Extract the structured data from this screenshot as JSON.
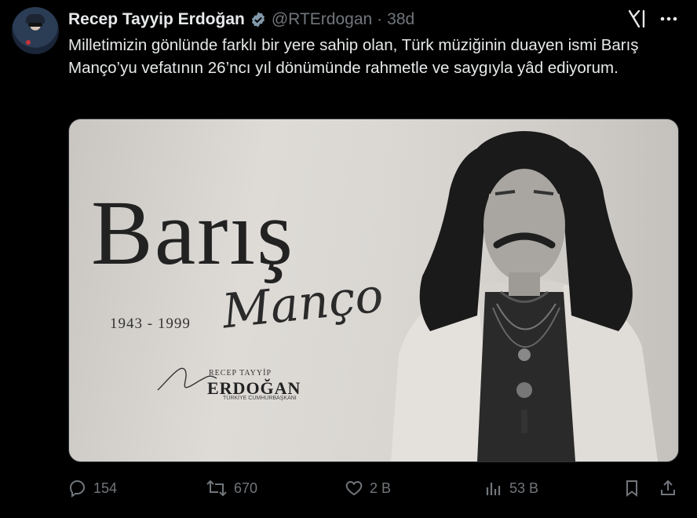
{
  "tweet": {
    "author_name": "Recep Tayyip Erdoğan",
    "handle": "@RTErdogan",
    "separator": "·",
    "time": "38d",
    "text": "Milletimizin gönlünde farklı bir yere sahip olan, Türk müziğinin duayen ismi Barış Manço’yu vefatının 26’ncı yıl dönümünde rahmetle ve saygıyla yâd ediyorum.",
    "verified_color": "#829aab"
  },
  "media": {
    "title": "Barış",
    "script": "Manço",
    "years": "1943 - 1999",
    "signature_top": "RECEP TAYYİP",
    "signature_name": "ERDOĞAN",
    "signature_sub": "TÜRKİYE CUMHURBAŞKANI"
  },
  "actions": {
    "replies": "154",
    "reposts": "670",
    "likes": "2 B",
    "views": "53 B"
  },
  "icons": [
    "grok-icon",
    "more-icon",
    "reply-icon",
    "repost-icon",
    "like-icon",
    "views-icon",
    "bookmark-icon",
    "share-icon",
    "verified-icon"
  ]
}
